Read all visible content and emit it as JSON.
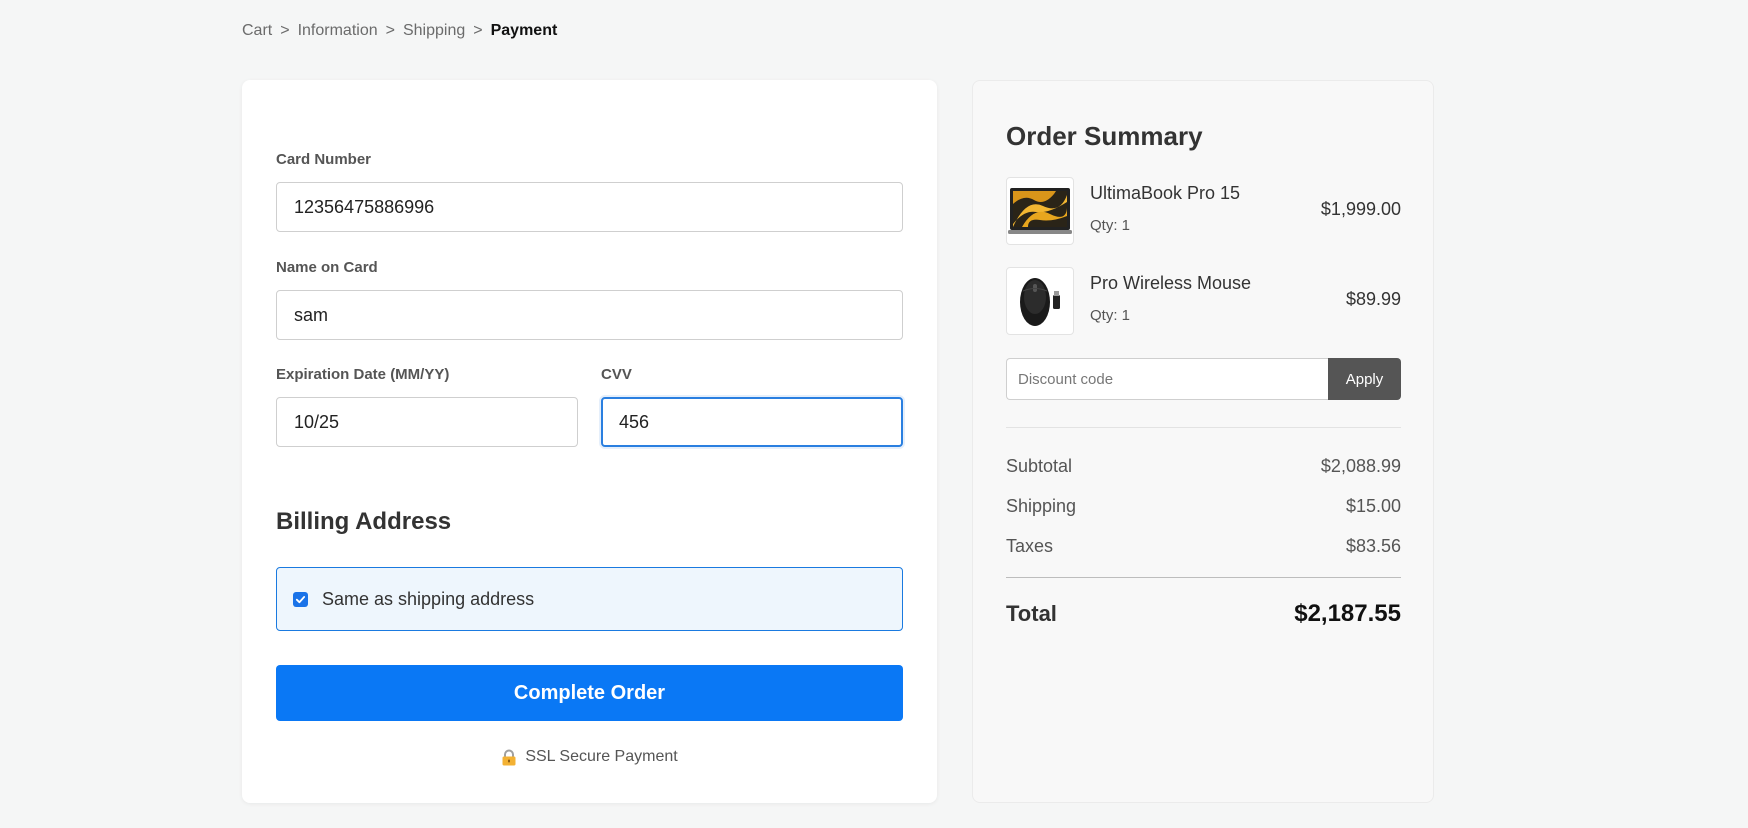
{
  "breadcrumb": {
    "items": [
      "Cart",
      "Information",
      "Shipping"
    ],
    "separator": ">",
    "current": "Payment"
  },
  "payment_form": {
    "card_number": {
      "label": "Card Number",
      "value": "12356475886996"
    },
    "name_on_card": {
      "label": "Name on Card",
      "value": "sam"
    },
    "expiration": {
      "label": "Expiration Date (MM/YY)",
      "value": "10/25"
    },
    "cvv": {
      "label": "CVV",
      "value": "456"
    }
  },
  "billing": {
    "heading": "Billing Address",
    "same_as_shipping_label": "Same as shipping address",
    "same_as_shipping_checked": true
  },
  "complete_button_label": "Complete Order",
  "secure_note": "SSL Secure Payment",
  "summary": {
    "title": "Order Summary",
    "items": [
      {
        "name": "UltimaBook Pro 15",
        "qty": "Qty: 1",
        "price": "$1,999.00",
        "icon": "laptop-thumbnail"
      },
      {
        "name": "Pro Wireless Mouse",
        "qty": "Qty: 1",
        "price": "$89.99",
        "icon": "mouse-thumbnail"
      }
    ],
    "discount_placeholder": "Discount code",
    "apply_label": "Apply",
    "subtotal_label": "Subtotal",
    "subtotal_value": "$2,088.99",
    "shipping_label": "Shipping",
    "shipping_value": "$15.00",
    "taxes_label": "Taxes",
    "taxes_value": "$83.56",
    "total_label": "Total",
    "total_value": "$2,187.55"
  },
  "colors": {
    "primary": "#0a78f5",
    "focus": "#2a7fe0",
    "apply_button": "#555555",
    "billing_box_bg": "#eef6fd"
  }
}
